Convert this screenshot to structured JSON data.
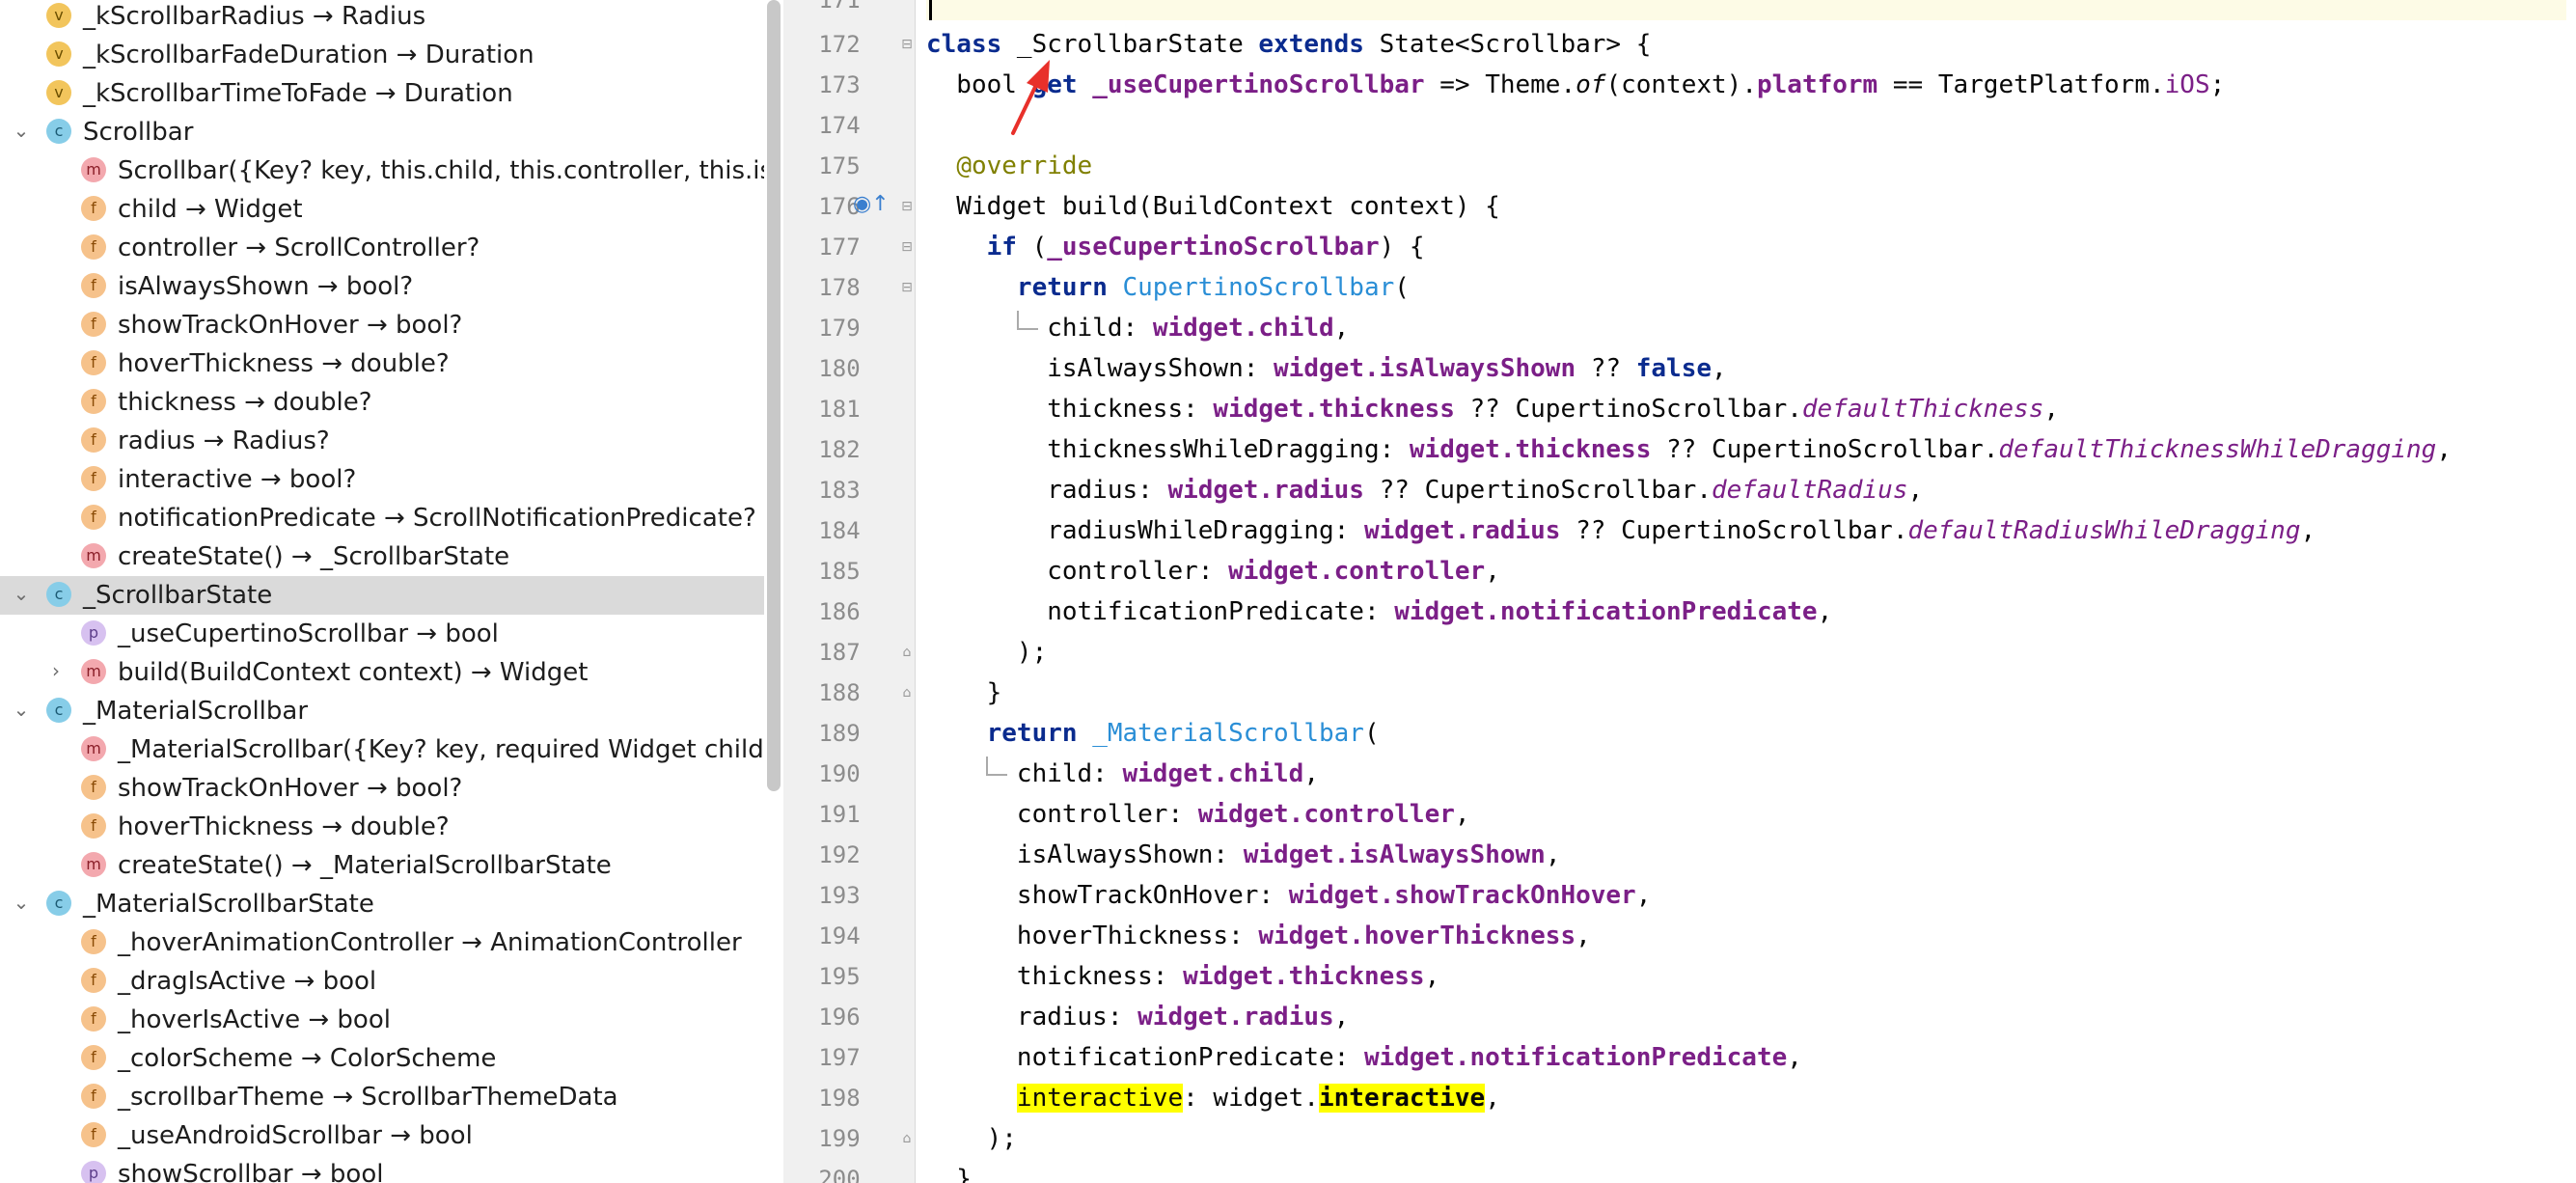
{
  "structure": {
    "items": [
      {
        "badge": "v",
        "label": "_kScrollbarRadius → Radius"
      },
      {
        "badge": "v",
        "label": "_kScrollbarFadeDuration → Duration"
      },
      {
        "badge": "v",
        "label": "_kScrollbarTimeToFade → Duration"
      },
      {
        "badge": "c",
        "label": "Scrollbar"
      },
      {
        "badge": "m",
        "label": "Scrollbar({Key? key, this.child, this.controller, this.isAlw"
      },
      {
        "badge": "f",
        "label": "child → Widget"
      },
      {
        "badge": "f",
        "label": "controller → ScrollController?"
      },
      {
        "badge": "f",
        "label": "isAlwaysShown → bool?"
      },
      {
        "badge": "f",
        "label": "showTrackOnHover → bool?"
      },
      {
        "badge": "f",
        "label": "hoverThickness → double?"
      },
      {
        "badge": "f",
        "label": "thickness → double?"
      },
      {
        "badge": "f",
        "label": "radius → Radius?"
      },
      {
        "badge": "f",
        "label": "interactive → bool?"
      },
      {
        "badge": "f",
        "label": "notificationPredicate → ScrollNotificationPredicate?"
      },
      {
        "badge": "m",
        "label": "createState() → _ScrollbarState"
      },
      {
        "badge": "c",
        "label": "_ScrollbarState"
      },
      {
        "badge": "p",
        "label": "_useCupertinoScrollbar → bool"
      },
      {
        "badge": "m",
        "label": "build(BuildContext context) → Widget"
      },
      {
        "badge": "c",
        "label": "_MaterialScrollbar"
      },
      {
        "badge": "m",
        "label": "_MaterialScrollbar({Key? key, required Widget child, Sc"
      },
      {
        "badge": "f",
        "label": "showTrackOnHover → bool?"
      },
      {
        "badge": "f",
        "label": "hoverThickness → double?"
      },
      {
        "badge": "m",
        "label": "createState() → _MaterialScrollbarState"
      },
      {
        "badge": "c",
        "label": "_MaterialScrollbarState"
      },
      {
        "badge": "f",
        "label": "_hoverAnimationController → AnimationController"
      },
      {
        "badge": "f",
        "label": "_dragIsActive → bool"
      },
      {
        "badge": "f",
        "label": "_hoverIsActive → bool"
      },
      {
        "badge": "f",
        "label": "_colorScheme → ColorScheme"
      },
      {
        "badge": "f",
        "label": "_scrollbarTheme → ScrollbarThemeData"
      },
      {
        "badge": "f",
        "label": "_useAndroidScrollbar → bool"
      },
      {
        "badge": "p",
        "label": "showScrollbar → bool"
      }
    ]
  },
  "editor": {
    "line_numbers": [
      "171",
      "172",
      "173",
      "174",
      "175",
      "176",
      "177",
      "178",
      "179",
      "180",
      "181",
      "182",
      "183",
      "184",
      "185",
      "186",
      "187",
      "188",
      "189",
      "190",
      "191",
      "192",
      "193",
      "194",
      "195",
      "196",
      "197",
      "198",
      "199",
      "200"
    ],
    "code": {
      "l172": {
        "a": "class",
        "b": " _ScrollbarState ",
        "c": "extends",
        "d": " State<Scrollbar> {"
      },
      "l173": {
        "a": "  bool ",
        "b": "get",
        "c": " _useCupertinoScrollbar",
        "d": " => Theme.",
        "e": "of",
        "f": "(context).",
        "g": "platform",
        "h": " == TargetPlatform.",
        "i": "iOS",
        "j": ";"
      },
      "l175": {
        "a": "  ",
        "b": "@override"
      },
      "l176": {
        "a": "  Widget build(BuildContext context) {"
      },
      "l177": {
        "a": "    ",
        "b": "if",
        "c": " (",
        "d": "_useCupertinoScrollbar",
        "e": ") {"
      },
      "l178": {
        "a": "      ",
        "b": "return",
        "c": " ",
        "d": "CupertinoScrollbar",
        "e": "("
      },
      "l179": {
        "a": "        child: ",
        "b": "widget.child",
        "c": ","
      },
      "l180": {
        "a": "        isAlwaysShown: ",
        "b": "widget.isAlwaysShown",
        "c": " ?? ",
        "d": "false",
        "e": ","
      },
      "l181": {
        "a": "        thickness: ",
        "b": "widget.thickness",
        "c": " ?? CupertinoScrollbar.",
        "d": "defaultThickness",
        "e": ","
      },
      "l182": {
        "a": "        thicknessWhileDragging: ",
        "b": "widget.thickness",
        "c": " ?? CupertinoScrollbar.",
        "d": "defaultThicknessWhileDragging",
        "e": ","
      },
      "l183": {
        "a": "        radius: ",
        "b": "widget.radius",
        "c": " ?? CupertinoScrollbar.",
        "d": "defaultRadius",
        "e": ","
      },
      "l184": {
        "a": "        radiusWhileDragging: ",
        "b": "widget.radius",
        "c": " ?? CupertinoScrollbar.",
        "d": "defaultRadiusWhileDragging",
        "e": ","
      },
      "l185": {
        "a": "        controller: ",
        "b": "widget.controller",
        "c": ","
      },
      "l186": {
        "a": "        notificationPredicate: ",
        "b": "widget.notificationPredicate",
        "c": ","
      },
      "l187": {
        "a": "      );"
      },
      "l188": {
        "a": "    }"
      },
      "l189": {
        "a": "    ",
        "b": "return",
        "c": " ",
        "d": "_MaterialScrollbar",
        "e": "("
      },
      "l190": {
        "a": "      child: ",
        "b": "widget.child",
        "c": ","
      },
      "l191": {
        "a": "      controller: ",
        "b": "widget.controller",
        "c": ","
      },
      "l192": {
        "a": "      isAlwaysShown: ",
        "b": "widget.isAlwaysShown",
        "c": ","
      },
      "l193": {
        "a": "      showTrackOnHover: ",
        "b": "widget.showTrackOnHover",
        "c": ","
      },
      "l194": {
        "a": "      hoverThickness: ",
        "b": "widget.hoverThickness",
        "c": ","
      },
      "l195": {
        "a": "      thickness: ",
        "b": "widget.thickness",
        "c": ","
      },
      "l196": {
        "a": "      radius: ",
        "b": "widget.radius",
        "c": ","
      },
      "l197": {
        "a": "      notificationPredicate: ",
        "b": "widget.notificationPredicate",
        "c": ","
      },
      "l198": {
        "a": "      ",
        "b": "interactive",
        "c": ": widget.",
        "d": "interactive",
        "e": ","
      },
      "l199": {
        "a": "    );"
      },
      "l200": {
        "a": "  }"
      }
    }
  },
  "colors": {
    "highlight": "#ffff00",
    "arrow": "#e8302a",
    "keyword": "#0a2b8e",
    "property": "#7b1f87",
    "class_ref": "#2a8ed6"
  }
}
